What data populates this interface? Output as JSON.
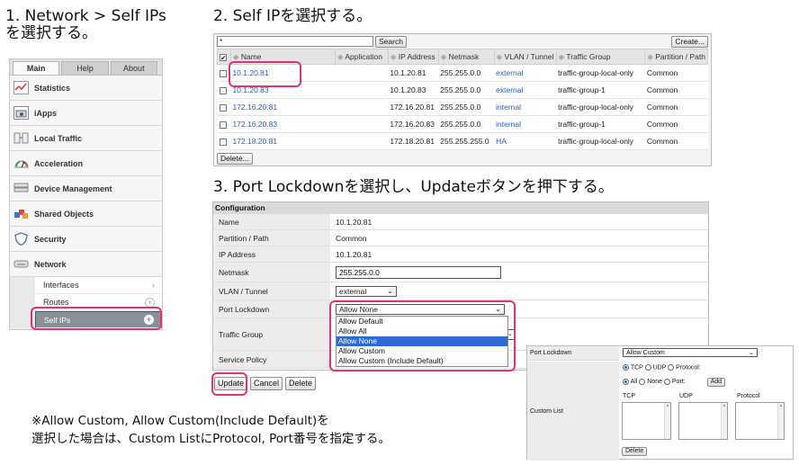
{
  "steps": {
    "step1_line1": "1. Network > Self IPs",
    "step1_line2": "を選択する。",
    "step2": "2. Self IPを選択する。",
    "step3": "3. Port Lockdownを選択し、Updateボタンを押下する。"
  },
  "nav": {
    "tabs": [
      "Main",
      "Help",
      "About"
    ],
    "items": [
      "Statistics",
      "iApps",
      "Local Traffic",
      "Acceleration",
      "Device Management",
      "Shared Objects",
      "Security",
      "Network"
    ],
    "subitems": [
      "Interfaces",
      "Routes",
      "Self IPs"
    ],
    "sub_marks": [
      "›",
      "+",
      "+"
    ]
  },
  "selfip_list": {
    "search_value": "*",
    "search_button": "Search",
    "create_button": "Create...",
    "columns": [
      "Name",
      "Application",
      "IP Address",
      "Netmask",
      "VLAN / Tunnel",
      "Traffic Group",
      "Partition / Path"
    ],
    "rows": [
      [
        "10.1.20.81",
        "",
        "10.1.20.81",
        "255.255.0.0",
        "external",
        "traffic-group-local-only",
        "Common"
      ],
      [
        "10.1.20.83",
        "",
        "10.1.20.83",
        "255.255.0.0",
        "external",
        "traffic-group-1",
        "Common"
      ],
      [
        "172.16.20.81",
        "",
        "172.16.20.81",
        "255.255.0.0",
        "internal",
        "traffic-group-local-only",
        "Common"
      ],
      [
        "172.16.20.83",
        "",
        "172.16.20.83",
        "255.255.0.0",
        "internal",
        "traffic-group-1",
        "Common"
      ],
      [
        "172.18.20.81",
        "",
        "172.18.20.81",
        "255.255.255.0",
        "HA",
        "traffic-group-local-only",
        "Common"
      ]
    ],
    "delete_button": "Delete..."
  },
  "config": {
    "header": "Configuration",
    "name_label": "Name",
    "name_value": "10.1.20.81",
    "partition_label": "Partition / Path",
    "partition_value": "Common",
    "ip_label": "IP Address",
    "ip_value": "10.1.20.81",
    "netmask_label": "Netmask",
    "netmask_value": "255.255.0.0",
    "vlan_label": "VLAN / Tunnel",
    "vlan_value": "external",
    "port_lockdown_label": "Port Lockdown",
    "port_lockdown_value": "Allow None",
    "traffic_group_label": "Traffic Group",
    "service_policy_label": "Service Policy",
    "dropdown_options": [
      "Allow Default",
      "Allow All",
      "Allow None",
      "Allow Custom",
      "Allow Custom (Include Default)"
    ],
    "dropdown_selected": "Allow None",
    "update_button": "Update",
    "cancel_button": "Cancel",
    "delete_button": "Delete"
  },
  "custom_inset": {
    "port_lockdown_label": "Port Lockdown",
    "port_lockdown_value": "Allow Custom",
    "protocol_options": [
      "TCP",
      "UDP",
      "Protocol:"
    ],
    "port_options": [
      "All",
      "None",
      "Port:"
    ],
    "add_button": "Add",
    "custom_list_label": "Custom List",
    "list_headers": [
      "TCP",
      "UDP",
      "Protocol"
    ],
    "delete_button": "Delete"
  },
  "note": {
    "line1": "※Allow Custom, Allow Custom(Include Default)を",
    "line2": "選択した場合は、Custom ListにProtocol, Port番号を指定する。"
  },
  "colors": {
    "highlight": "#e0327a",
    "link": "#2a5db0",
    "selection": "#2d6ad6"
  }
}
